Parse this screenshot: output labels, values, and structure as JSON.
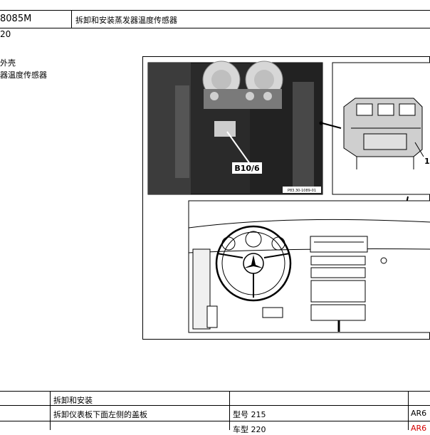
{
  "header": {
    "code": "8085M",
    "title": "拆卸和安装蒸发器温度传感器"
  },
  "model_line": "20",
  "parts": [
    "外壳",
    "器温度传感器"
  ],
  "figure": {
    "callout_sensor": "B10/6",
    "callout_one": "1",
    "photo_ref": "P83.30-1089-01"
  },
  "table": {
    "row1": {
      "col2": "拆卸和安装"
    },
    "row2": {
      "col2": "拆卸仪表板下面左侧的盖板",
      "col3": "型号 215",
      "col4": "AR6"
    },
    "row3": {
      "col3": "车型 220",
      "col4": "AR6"
    }
  },
  "colors": {
    "link_red": "#d40000"
  }
}
